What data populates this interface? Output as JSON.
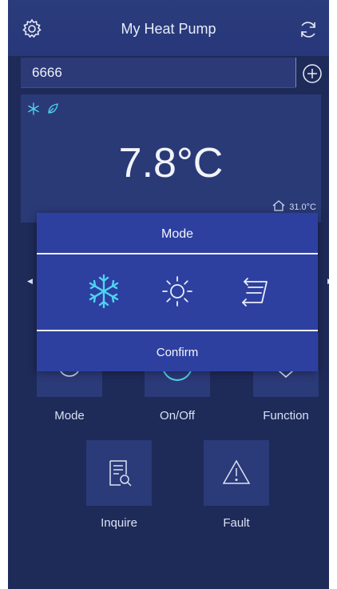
{
  "header": {
    "title": "My Heat Pump",
    "settings_icon": "gear-icon",
    "refresh_icon": "refresh-icon"
  },
  "device": {
    "name": "6666",
    "add_icon": "plus-circle-icon"
  },
  "status": {
    "temperature": "7.8°C",
    "outdoor_temperature": "31.0°C",
    "icons": [
      "snowflake-icon",
      "leaf-icon",
      "house-icon"
    ]
  },
  "mode_dialog": {
    "title": "Mode",
    "options": [
      "cool-mode-icon",
      "heat-mode-icon",
      "auto-mode-icon"
    ],
    "selected": "cool-mode-icon",
    "confirm_label": "Confirm"
  },
  "functions": {
    "mode_label": "Mode",
    "onoff_label": "On/Off",
    "function_label": "Function",
    "inquire_label": "Inquire",
    "fault_label": "Fault"
  },
  "colors": {
    "background": "#1e2a58",
    "panel": "#2a3a77",
    "dialog": "#2d40a0",
    "accent_cyan": "#4fd3f0",
    "text": "#ffffff"
  }
}
